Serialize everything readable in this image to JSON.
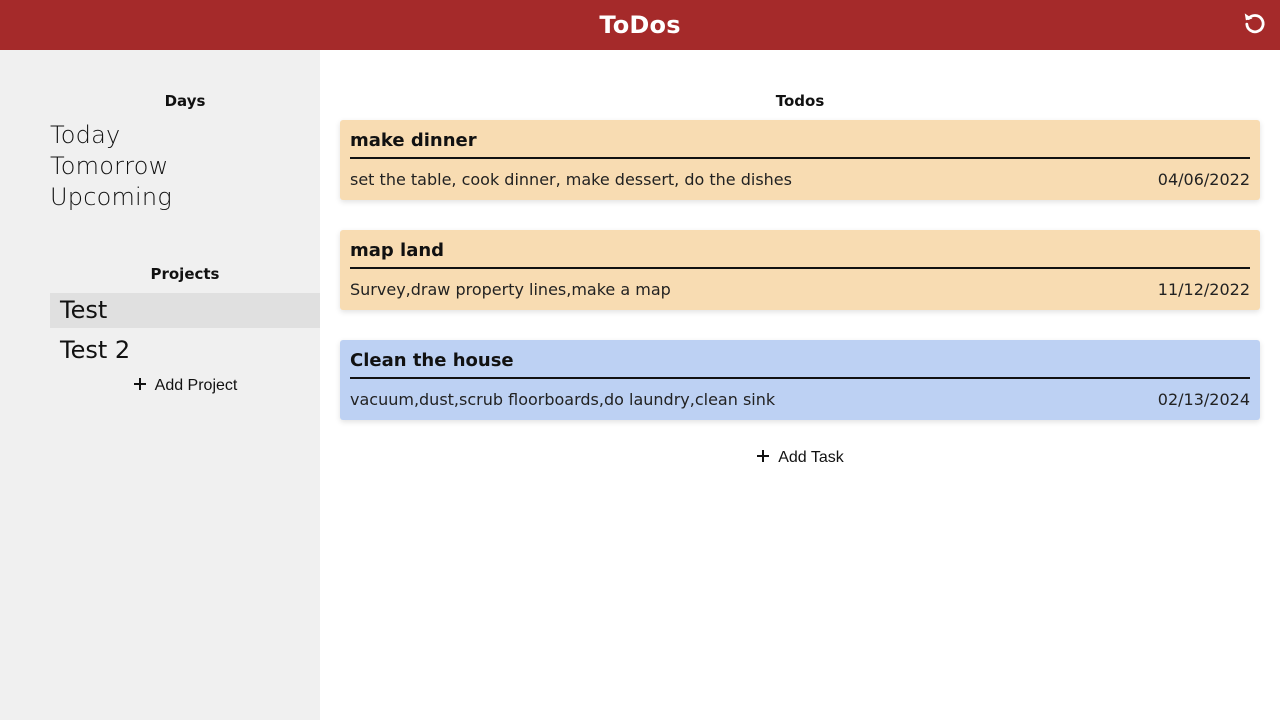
{
  "header": {
    "title": "ToDos",
    "reset_icon": "reset-icon",
    "background": "#a52a2a"
  },
  "sidebar": {
    "days_heading": "Days",
    "days": [
      {
        "label": "Today"
      },
      {
        "label": "Tomorrow"
      },
      {
        "label": "Upcoming"
      }
    ],
    "projects_heading": "Projects",
    "projects": [
      {
        "label": "Test",
        "selected": true
      },
      {
        "label": "Test 2",
        "selected": false
      }
    ],
    "add_project_label": "Add Project",
    "add_project_icon": "plus-icon",
    "background": "#f0f0f0"
  },
  "main": {
    "heading": "Todos",
    "todos": [
      {
        "title": "make dinner",
        "description": "set the table, cook dinner, make dessert, do the dishes",
        "date": "04/06/2022",
        "color": "#f8dcb2"
      },
      {
        "title": "map land",
        "description": "Survey,draw property lines,make a map",
        "date": "11/12/2022",
        "color": "#f8dcb2"
      },
      {
        "title": "Clean the house",
        "description": "vacuum,dust,scrub floorboards,do laundry,clean sink",
        "date": "02/13/2024",
        "color": "#bdd1f3"
      }
    ],
    "add_task_label": "Add Task",
    "add_task_icon": "plus-icon"
  }
}
